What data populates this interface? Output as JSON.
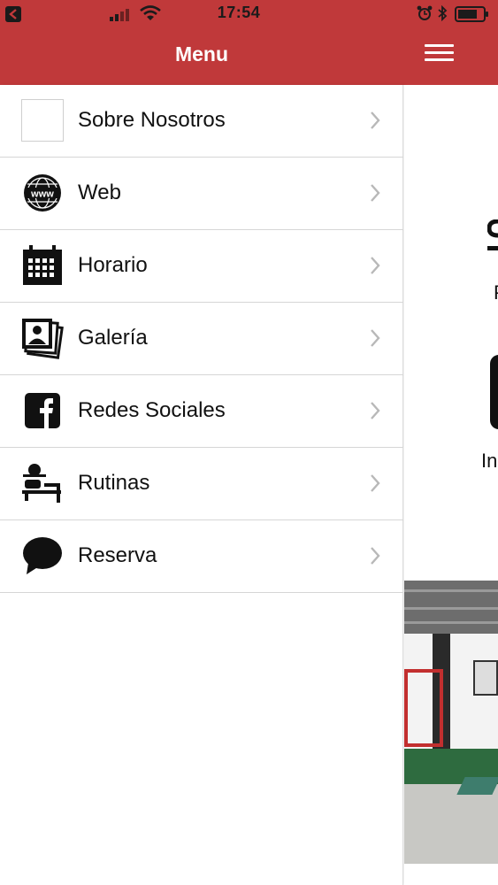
{
  "status_bar": {
    "time": "17:54"
  },
  "header": {
    "title": "Menu"
  },
  "menu": {
    "items": [
      {
        "label": "Sobre Nosotros",
        "icon": "blank-image-icon"
      },
      {
        "label": "Web",
        "icon": "globe-www-icon"
      },
      {
        "label": "Horario",
        "icon": "calendar-icon"
      },
      {
        "label": "Galería",
        "icon": "photos-icon"
      },
      {
        "label": "Redes Sociales",
        "icon": "facebook-icon"
      },
      {
        "label": "Rutinas",
        "icon": "bench-press-icon"
      },
      {
        "label": "Reserva",
        "icon": "speech-bubble-icon"
      }
    ]
  },
  "content": {
    "fragment_p": "P",
    "fragment_in": "In"
  },
  "colors": {
    "header_red": "#c0393a",
    "divider": "#d6d6d6",
    "text": "#111111"
  }
}
